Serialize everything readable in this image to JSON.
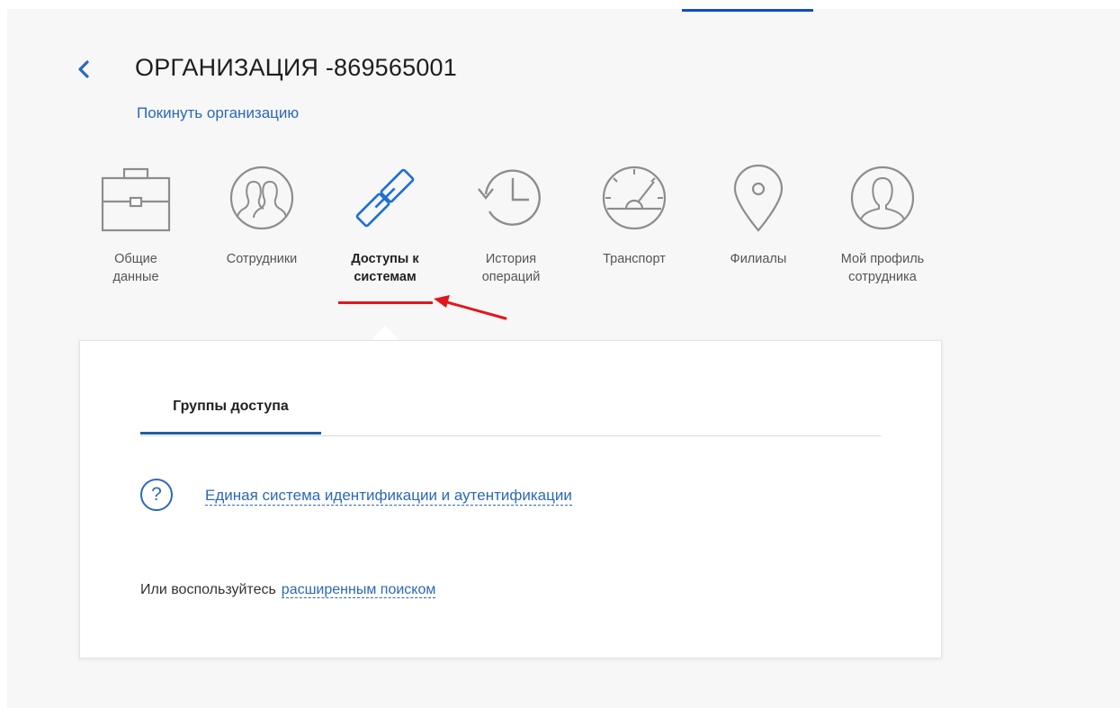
{
  "header": {
    "title": "ОРГАНИЗАЦИЯ -869565001",
    "leave_link": "Покинуть организацию"
  },
  "nav": {
    "items": [
      {
        "label_line1": "Общие",
        "label_line2": "данные",
        "icon": "briefcase-icon"
      },
      {
        "label_line1": "Сотрудники",
        "label_line2": "",
        "icon": "users-icon"
      },
      {
        "label_line1": "Доступы к",
        "label_line2": "системам",
        "icon": "chain-link-icon",
        "active": true
      },
      {
        "label_line1": "История",
        "label_line2": "операций",
        "icon": "history-clock-icon"
      },
      {
        "label_line1": "Транспорт",
        "label_line2": "",
        "icon": "speedometer-icon"
      },
      {
        "label_line1": "Филиалы",
        "label_line2": "",
        "icon": "location-pin-icon"
      },
      {
        "label_line1": "Мой профиль",
        "label_line2": "сотрудника",
        "icon": "user-profile-icon"
      }
    ]
  },
  "panel": {
    "tab_label": "Группы доступа",
    "help_symbol": "?",
    "system_link": "Единая система идентификации и аутентификации",
    "search_prefix": "Или воспользуйтесь",
    "search_link": "расширенным поиском"
  },
  "colors": {
    "accent": "#2b68b9",
    "icon_primary": "#1f6fd1",
    "annotation": "#e2171d",
    "tab_active": "#1e5ea8"
  }
}
